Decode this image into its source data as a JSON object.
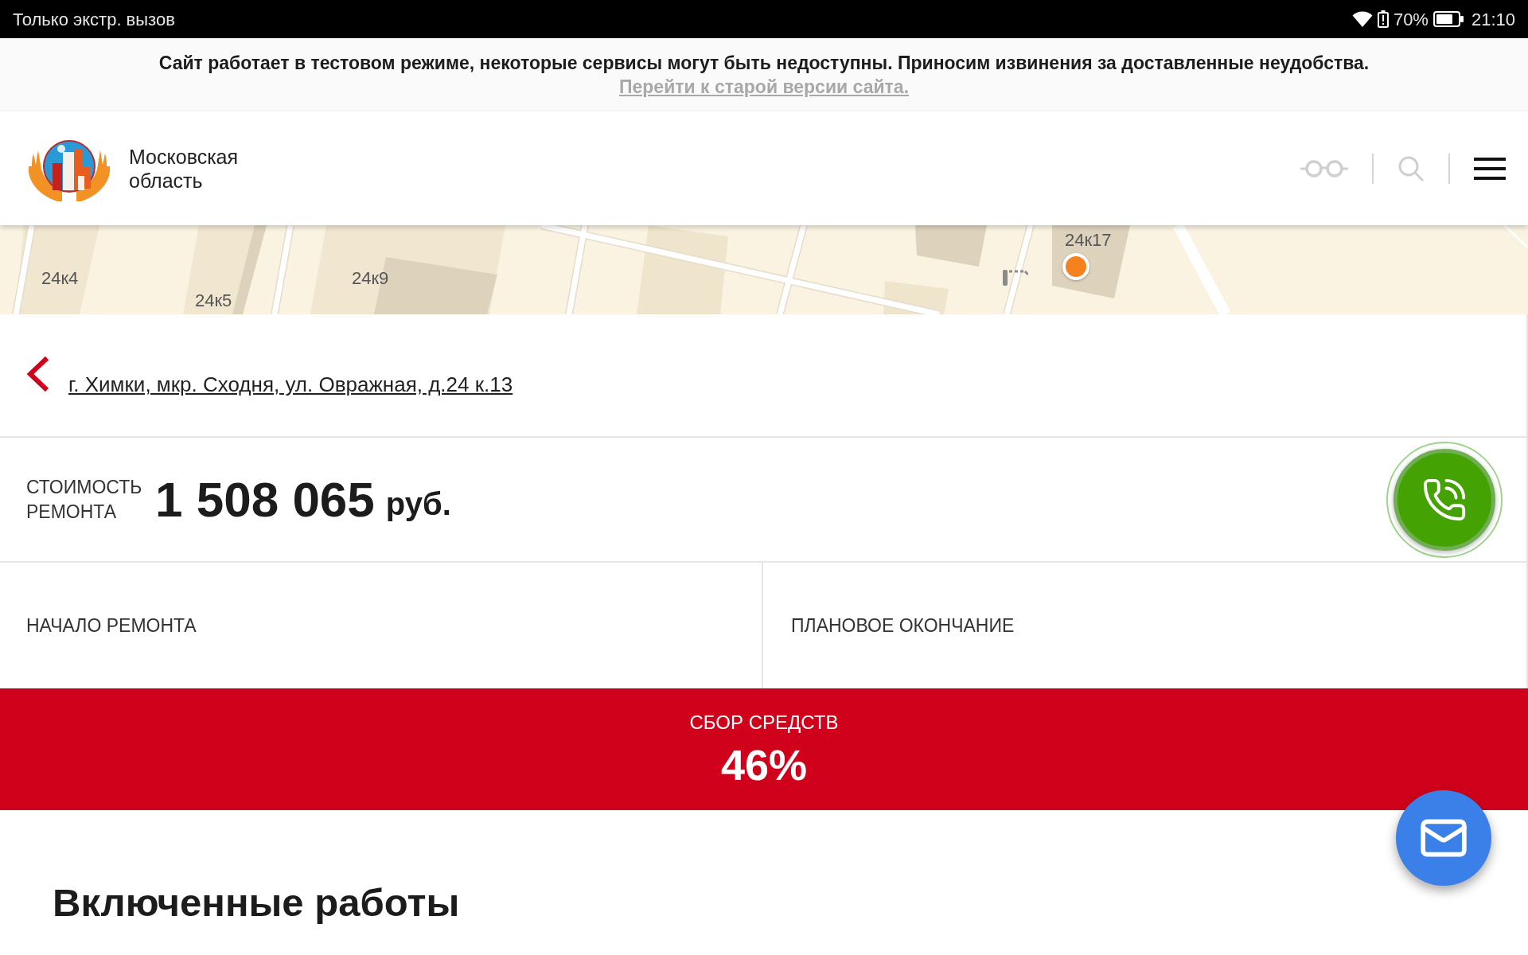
{
  "status_bar": {
    "carrier_text": "Только экстр. вызов",
    "battery_percent": "70%",
    "time": "21:10"
  },
  "notice": {
    "text": "Сайт работает в тестовом режиме, некоторые сервисы могут быть недоступны. Приносим извинения за доставленные неудобства.",
    "link": "Перейти к старой версии сайта."
  },
  "header": {
    "region_name": "Московская область"
  },
  "map": {
    "labels": [
      "24к4",
      "24к5",
      "24к9",
      "24к17"
    ]
  },
  "address": {
    "link": "г. Химки, мкр. Сходня, ул. Овражная, д.24 к.13"
  },
  "cost": {
    "label": "СТОИМОСТЬ РЕМОНТА",
    "amount": "1 508 065",
    "currency": "руб."
  },
  "dates": [
    {
      "label": "НАЧАЛО РЕМОНТА"
    },
    {
      "label": "ПЛАНОВОЕ ОКОНЧАНИЕ"
    }
  ],
  "fundraising": {
    "label": "СБОР СРЕДСТВ",
    "percent": "46%"
  },
  "section": {
    "title": "Включенные работы"
  }
}
